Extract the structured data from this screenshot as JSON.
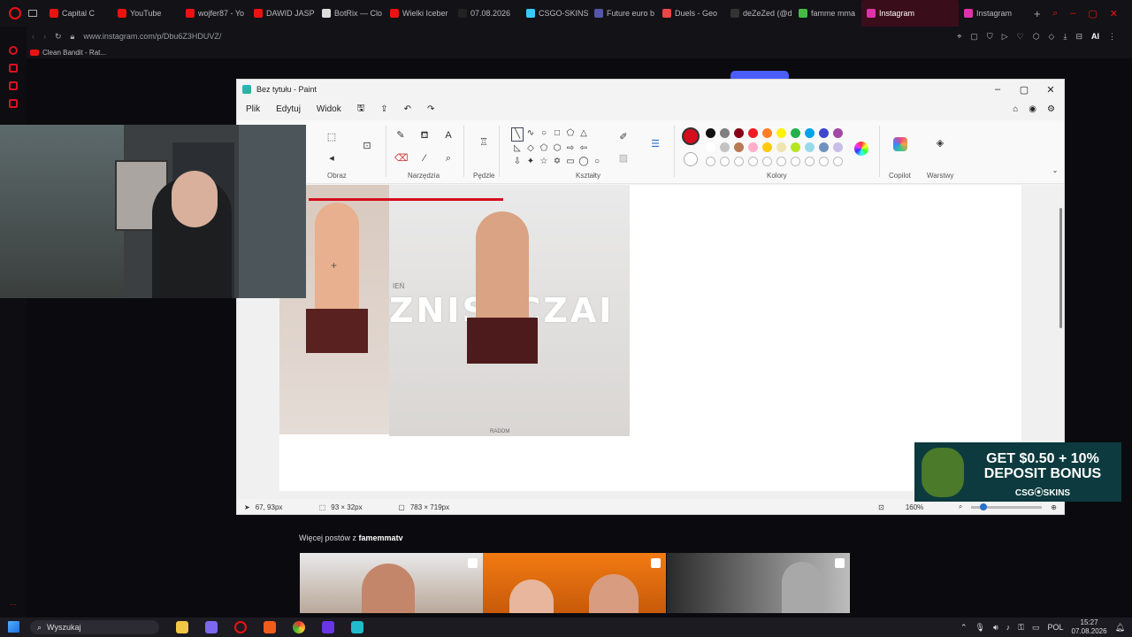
{
  "browser": {
    "tabs": [
      {
        "label": "Capital C",
        "color": "#e11"
      },
      {
        "label": "YouTube",
        "color": "#e11"
      },
      {
        "label": "wojfer87 - Yo",
        "color": "#e11"
      },
      {
        "label": "DAWID JASP",
        "color": "#e11"
      },
      {
        "label": "BotRix — Clo",
        "color": "#ddd"
      },
      {
        "label": "Wielki Iceber",
        "color": "#e11"
      },
      {
        "label": "07.08.2026",
        "color": "#222"
      },
      {
        "label": "CSGO-SKINS",
        "color": "#3cf"
      },
      {
        "label": "Future euro b",
        "color": "#55a"
      },
      {
        "label": "Duels - Geo",
        "color": "#e44"
      },
      {
        "label": "deZeZed (@d",
        "color": "#333"
      },
      {
        "label": "famme mma",
        "color": "#4b4"
      },
      {
        "label": "Instagram",
        "color": "#d3a"
      },
      {
        "label": "Instagram",
        "color": "#d3a"
      }
    ],
    "url": "www.instagram.com/p/Dbu6Z3HDUVZ/",
    "ai_label": "AI",
    "bookmark": "Clean Bandit - Rat..."
  },
  "paint": {
    "title": "Bez tytułu - Paint",
    "menu": [
      "Plik",
      "Edytuj",
      "Widok"
    ],
    "groups": {
      "image": "Obraz",
      "tools": "Narzędzia",
      "brushes": "Pędzle",
      "shapes": "Kształty",
      "colors": "Kolory",
      "copilot": "Copilot",
      "layers": "Warstwy"
    },
    "palette_row1": [
      "#111111",
      "#7f7f7f",
      "#880015",
      "#ed1c24",
      "#ff7f27",
      "#fff200",
      "#22b14c",
      "#00a2e8",
      "#3f48cc",
      "#a349a4"
    ],
    "palette_row2": [
      "#ffffff",
      "#c3c3c3",
      "#b97a57",
      "#ffaec9",
      "#ffc90e",
      "#efe4b0",
      "#b5e61d",
      "#99d9ea",
      "#7092be",
      "#c8bfe7"
    ],
    "primary_color": "#d50d1c",
    "canvas_text": "ZNISZCZAI",
    "canvas_text_small": "IEŃ",
    "canvas_caption": "RADOM",
    "status": {
      "cursor": "67, 93px",
      "selection": "93 × 32px",
      "size": "783 × 719px",
      "zoom": "160%"
    }
  },
  "page": {
    "more_posts_prefix": "Więcej postów z",
    "more_posts_user": "famemmatv"
  },
  "ad": {
    "line1": "GET $0.50 + 10%",
    "line2": "DEPOSIT BONUS",
    "brand": "CSG⦿SKINS"
  },
  "taskbar": {
    "search_placeholder": "Wyszukaj",
    "lang": "POL",
    "time": "15:27",
    "date": "07.08.2026"
  }
}
